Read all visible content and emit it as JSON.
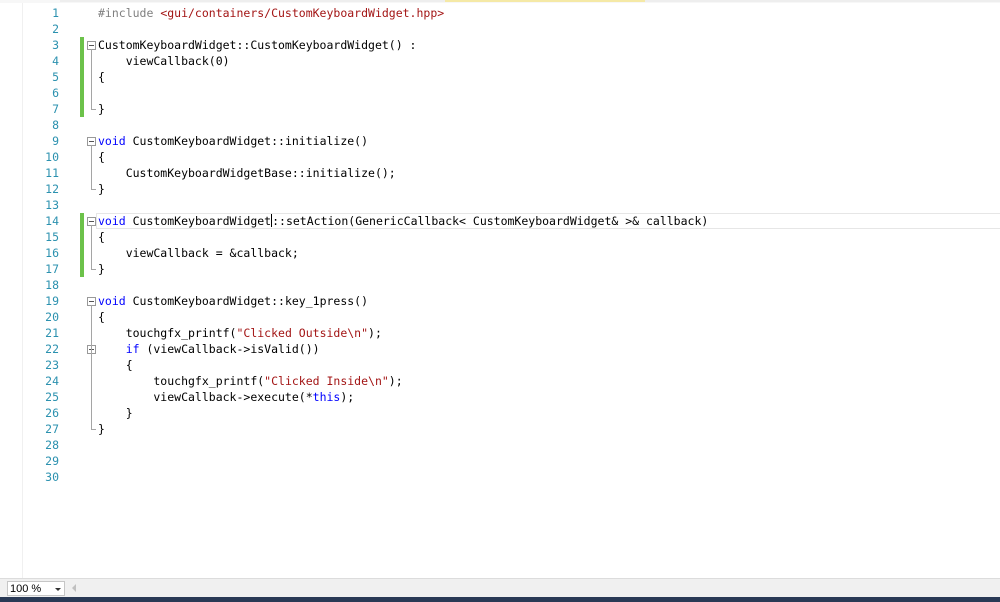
{
  "editor": {
    "lines": [
      {
        "num": "1",
        "html": "<span class=\"pp\">#include </span><span class=\"str\">&lt;gui/containers/CustomKeyboardWidget.hpp&gt;</span>"
      },
      {
        "num": "2",
        "html": ""
      },
      {
        "num": "3",
        "html": "CustomKeyboardWidget::CustomKeyboardWidget() :"
      },
      {
        "num": "4",
        "html": "    viewCallback(0)"
      },
      {
        "num": "5",
        "html": "{"
      },
      {
        "num": "6",
        "html": ""
      },
      {
        "num": "7",
        "html": "}"
      },
      {
        "num": "8",
        "html": ""
      },
      {
        "num": "9",
        "html": "<span class=\"kw\">void</span> CustomKeyboardWidget::initialize()"
      },
      {
        "num": "10",
        "html": "{"
      },
      {
        "num": "11",
        "html": "    CustomKeyboardWidgetBase::initialize();"
      },
      {
        "num": "12",
        "html": "}"
      },
      {
        "num": "13",
        "html": ""
      },
      {
        "num": "14",
        "html": "<span class=\"kw\">void</span> CustomKeyboardWidget<span class=\"caret\"></span>::setAction(GenericCallback&lt; CustomKeyboardWidget&amp; &gt;&amp; callback)"
      },
      {
        "num": "15",
        "html": "{"
      },
      {
        "num": "16",
        "html": "    viewCallback = &amp;callback;"
      },
      {
        "num": "17",
        "html": "}"
      },
      {
        "num": "18",
        "html": ""
      },
      {
        "num": "19",
        "html": "<span class=\"kw\">void</span> CustomKeyboardWidget::key_1press()"
      },
      {
        "num": "20",
        "html": "{"
      },
      {
        "num": "21",
        "html": "    touchgfx_printf(<span class=\"str\">\"Clicked Outside\\n\"</span>);"
      },
      {
        "num": "22",
        "html": "    <span class=\"kw\">if</span> (viewCallback-&gt;isValid())"
      },
      {
        "num": "23",
        "html": "    {"
      },
      {
        "num": "24",
        "html": "        touchgfx_printf(<span class=\"str\">\"Clicked Inside\\n\"</span>);"
      },
      {
        "num": "25",
        "html": "        viewCallback-&gt;execute(*<span class=\"kw\">this</span>);"
      },
      {
        "num": "26",
        "html": "    }"
      },
      {
        "num": "27",
        "html": "}"
      },
      {
        "num": "28",
        "html": ""
      },
      {
        "num": "29",
        "html": ""
      },
      {
        "num": "30",
        "html": ""
      }
    ]
  },
  "status": {
    "zoom": "100 %"
  }
}
